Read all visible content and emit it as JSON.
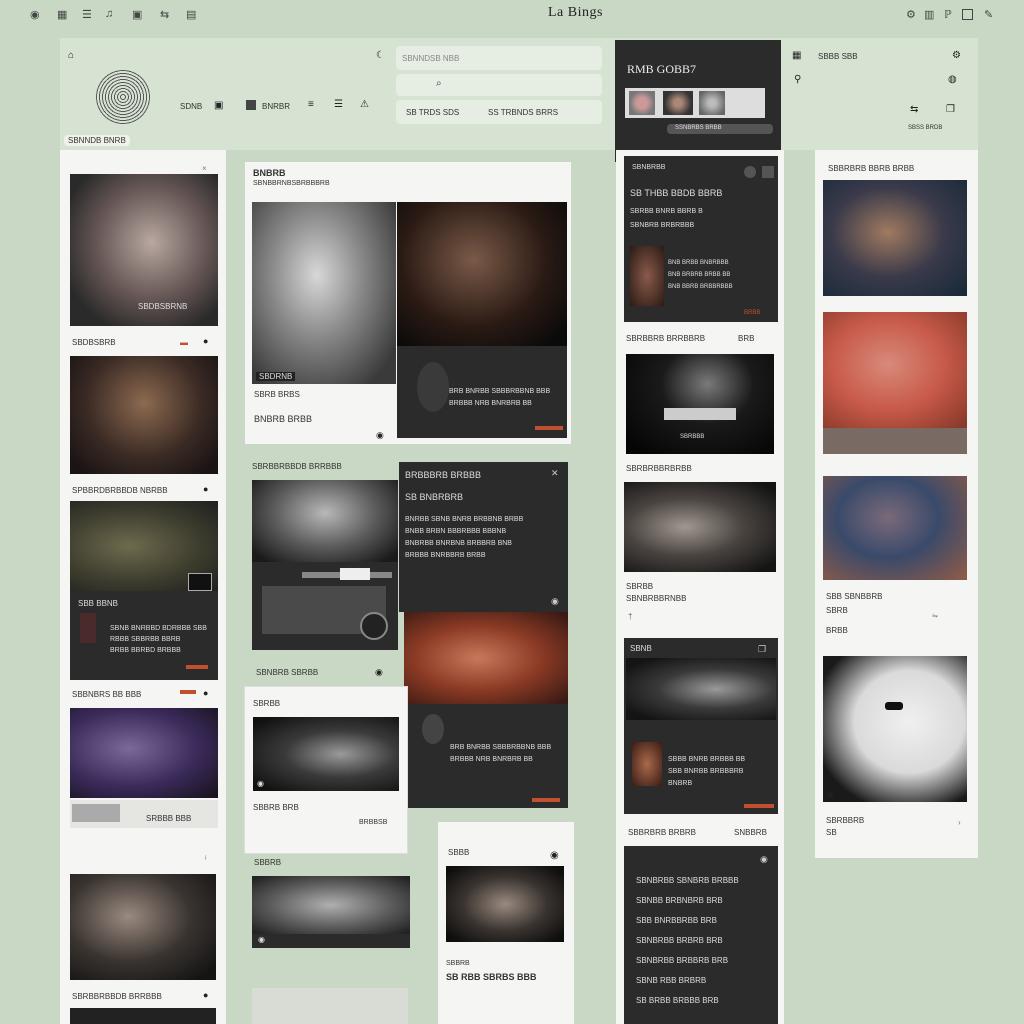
{
  "topbar": {
    "brand": "La Bings",
    "left_icons": [
      "user-icon",
      "grid-icon",
      "list-icon",
      "bell-icon",
      "image-icon"
    ],
    "right_icons": [
      "settings-icon",
      "archive-icon",
      "pin-icon",
      "window-icon",
      "edit-icon"
    ]
  },
  "header": {
    "nav": [
      "SDNB",
      "BNRBR"
    ],
    "caption": "SBNNDB BNRB",
    "search_placeholder": "SBNNDSB NBB",
    "search_tags": [
      "SB TRDS SDS",
      "SS TRBNDS BRRS"
    ],
    "player_title": "RMB GOBB7",
    "player_sub": "SSNBRBS BRBB",
    "right_label": "SBBB SBB",
    "right_small": "SBSS BRDB"
  },
  "col1": {
    "cards": [
      {
        "caption": "SBDBSBRB",
        "meta": "SBDBSBRNB"
      },
      {
        "caption": "SPBBRDBRBBDB NBRBB",
        "meta": ""
      },
      {
        "caption": "SBB BBNB",
        "body": [
          "SBNB BNRBBD BDRBBB SBB",
          "RBBB SBBRBB BBRB",
          "BRBB BBRBD BRBBB"
        ]
      },
      {
        "caption": "SBBNBRS BB BBB",
        "meta": "SRBBB BBB"
      },
      {
        "caption": "SBRBBRBBDB BRRBBB",
        "meta": ""
      }
    ]
  },
  "col2": {
    "title": "BNBRB",
    "subtitle": "SBNBBRNBSBRBBBRB",
    "card1": {
      "label": "SBRB BRBS",
      "meta": "BNBRB BRBB",
      "badge": "SBDRNB",
      "caption": "SBRBBRBBDB BRRBBB"
    },
    "card2": {
      "title": "BRBBBRB BRBBB",
      "subtitle": "SB BNBRBRB",
      "lines": [
        "BNRBB SBNB BNRB BRBBNB BRBB",
        "BNBB BRBN BBBRBBB BBBNB",
        "BNBRBB BNRBNB BRBBRB BNB",
        "BRBBB BNRBBRB BRBB"
      ],
      "caption": "SBNBRB SBRBB"
    },
    "card3": {
      "title": "SBRBB",
      "meta": "SBBRB BRB",
      "tag": "BRBBSB"
    },
    "card4": {
      "lines": [
        "BRB BNRBB SBBBRBBNB BBB",
        "BRBBB NRB BNRBRB BB"
      ]
    },
    "card5": {
      "title": "SBBB",
      "meta": "SBBRB",
      "caption": "SB RBB SBRBS BBB"
    }
  },
  "col3": {
    "card1": {
      "label": "SBNBRBB",
      "title": "SB THBB BBDB BBRB",
      "lines": [
        "SBRBB BNRB BBRB B",
        "SBNBRB BRBRBBB"
      ],
      "body": [
        "BNB BRBB BNBRBBB",
        "BNB BRBRB BRBB BB",
        "BNB BBRB BRBBRBBB"
      ],
      "tag": "BRBB"
    },
    "card2": {
      "caption": "SBRBBRB BRRBBRB",
      "meta": "BRB",
      "tag": "SBRBBB"
    },
    "card3": {
      "caption": "SBRBRBBRBRBB",
      "label": "SBRBB",
      "meta": "SBNBRBBRNBB"
    },
    "card4": {
      "title": "SBNB",
      "lines": [
        "SBBB BNRB BRBBB BB",
        "SBB BNRBB BRBBBRB",
        "BNBRB"
      ]
    },
    "card5": {
      "caption": "SBBRBRB BRBRB",
      "meta": "SNBBRB"
    },
    "card6": {
      "rows": [
        "SBNBRBB  SBNBRB BRBBB",
        "SBNBB  BRBNBRB BRB",
        "SBB  BNRBBRBB BRB",
        "SBNBRBB  BRBRB BRB",
        "SBNBRBB  BRBBRB BRB",
        "SBNB RBB  BRBRB",
        "SB BRBB  BRBBB BRB"
      ]
    }
  },
  "col4": {
    "title": "SBBRBRB BBRB BRBB",
    "cards": [
      {
        "caption": ""
      },
      {
        "caption": ""
      },
      {
        "caption": "SBB SBNBBRB",
        "meta": "SBRB",
        "tag": "BRBB"
      },
      {
        "caption": "SBRBBRB",
        "meta": "SB"
      }
    ]
  },
  "colors": {
    "bg": "#c9d8c4",
    "panel": "#f5f6f3",
    "dark": "#2b2b2b",
    "accent": "#c0502f"
  }
}
